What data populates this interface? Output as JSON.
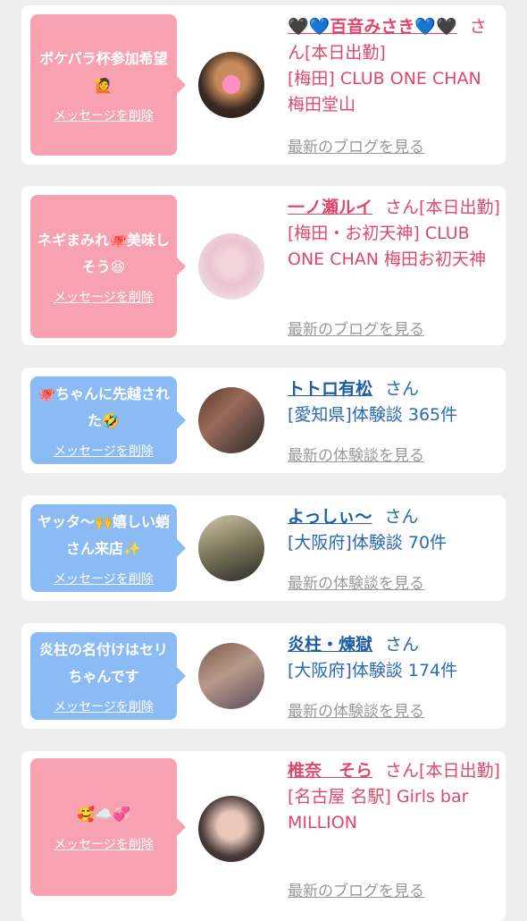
{
  "cards": [
    {
      "message": "ボケパラ杯参加希望🙋",
      "delete_label": "メッセージを削除",
      "name": "🖤💙百音みさき💙🖤",
      "san": "さん",
      "status": "[本日出勤]",
      "place": "[梅田] CLUB ONE CHAN 梅田堂山",
      "more": "最新のブログを見る"
    },
    {
      "message": "ネギまみれ🐙美味しそう😆",
      "delete_label": "メッセージを削除",
      "name": "一ノ瀬ルイ",
      "san": "さん",
      "status": "[本日出勤]",
      "place": "[梅田・お初天神] CLUB ONE CHAN 梅田お初天神",
      "more": "最新のブログを見る"
    },
    {
      "message": "🐙ちゃんに先越された🤣",
      "delete_label": "メッセージを削除",
      "name": "トトロ有松",
      "san": "さん",
      "detail": "[愛知県]体験談 365件",
      "more": "最新の体験談を見る"
    },
    {
      "message": "ヤッタ〜🙌嬉しい蛸さん来店✨",
      "delete_label": "メッセージを削除",
      "name": "よっしぃ〜",
      "san": "さん",
      "detail": "[大阪府]体験談 70件",
      "more": "最新の体験談を見る"
    },
    {
      "message": "炎柱の名付けはセリちゃんです",
      "delete_label": "メッセージを削除",
      "name": "炎柱・煉獄",
      "san": "さん",
      "detail": "[大阪府]体験談 174件",
      "more": "最新の体験談を見る"
    },
    {
      "message": "🥰☁️💞",
      "delete_label": "メッセージを削除",
      "name": "椎奈　そら",
      "san": "さん",
      "status": "[本日出勤]",
      "place": "[名古屋 名駅] Girls bar MILLION",
      "more": "最新のブログを見る"
    }
  ]
}
